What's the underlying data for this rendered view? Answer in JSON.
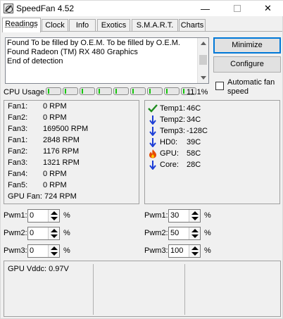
{
  "window": {
    "title": "SpeedFan 4.52",
    "minimize_glyph": "—",
    "close_glyph": "✕"
  },
  "tabs": [
    {
      "label": "Readings",
      "active": true
    },
    {
      "label": "Clock",
      "active": false
    },
    {
      "label": "Info",
      "active": false
    },
    {
      "label": "Exotics",
      "active": false
    },
    {
      "label": "S.M.A.R.T.",
      "active": false
    },
    {
      "label": "Charts",
      "active": false
    }
  ],
  "log": {
    "lines": [
      "Found To be filled by O.E.M. To be filled by O.E.M.",
      "Found Radeon (TM) RX 480 Graphics",
      "End of detection"
    ]
  },
  "buttons": {
    "minimize": "Minimize",
    "configure": "Configure"
  },
  "auto_fan": {
    "label": "Automatic fan speed",
    "checked": false
  },
  "cpu": {
    "label": "CPU Usage",
    "percent": "11.1%",
    "core_count": 10
  },
  "fans": [
    {
      "name": "Fan1:",
      "value": "0 RPM"
    },
    {
      "name": "Fan2:",
      "value": "0 RPM"
    },
    {
      "name": "Fan3:",
      "value": "169500 RPM"
    },
    {
      "name": "Fan1:",
      "value": "2848 RPM"
    },
    {
      "name": "Fan2:",
      "value": "1176 RPM"
    },
    {
      "name": "Fan3:",
      "value": "1321 RPM"
    },
    {
      "name": "Fan4:",
      "value": "0 RPM"
    },
    {
      "name": "Fan5:",
      "value": "0 RPM"
    },
    {
      "name": "GPU Fan:",
      "value": "724 RPM"
    }
  ],
  "temps": [
    {
      "name": "Temp1:",
      "value": "46C",
      "icon": "check-icon",
      "color": "#1e8c1e"
    },
    {
      "name": "Temp2:",
      "value": "34C",
      "icon": "arrow-down-icon",
      "color": "#1a3cd6"
    },
    {
      "name": "Temp3:",
      "value": "-128C",
      "icon": "arrow-down-icon",
      "color": "#1a3cd6"
    },
    {
      "name": "HD0:",
      "value": "39C",
      "icon": "arrow-down-icon",
      "color": "#1a3cd6"
    },
    {
      "name": "GPU:",
      "value": "58C",
      "icon": "flame-icon",
      "color": "#e64a00"
    },
    {
      "name": "Core:",
      "value": "28C",
      "icon": "arrow-down-icon",
      "color": "#1a3cd6"
    }
  ],
  "pwm_left": [
    {
      "label": "Pwm1:",
      "value": "0",
      "unit": "%"
    },
    {
      "label": "Pwm2:",
      "value": "0",
      "unit": "%"
    },
    {
      "label": "Pwm3:",
      "value": "0",
      "unit": "%"
    }
  ],
  "pwm_right": [
    {
      "label": "Pwm1:",
      "value": "30",
      "unit": "%"
    },
    {
      "label": "Pwm2:",
      "value": "50",
      "unit": "%"
    },
    {
      "label": "Pwm3:",
      "value": "100",
      "unit": "%"
    }
  ],
  "voltages": {
    "gpu_vddc": "GPU Vddc:   0.97V"
  }
}
